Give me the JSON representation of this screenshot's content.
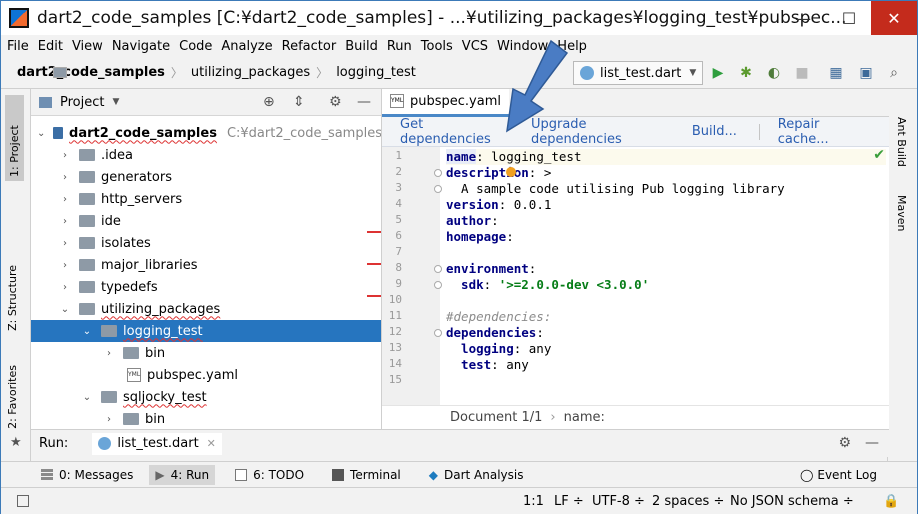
{
  "window": {
    "title": "dart2_code_samples [C:¥dart2_code_samples] - ...¥utilizing_packages¥logging_test¥pubspec...",
    "minimize": "—",
    "maximize": "☐",
    "close": "✕"
  },
  "menu": [
    "File",
    "Edit",
    "View",
    "Navigate",
    "Code",
    "Analyze",
    "Refactor",
    "Build",
    "Run",
    "Tools",
    "VCS",
    "Window",
    "Help"
  ],
  "breadcrumb": [
    "dart2_code_samples",
    "utilizing_packages",
    "logging_test"
  ],
  "run_config": "list_test.dart",
  "left_tool_tabs": {
    "project": "1: Project",
    "structure": "Z: Structure",
    "favorites": "2: Favorites"
  },
  "right_tool_tabs": {
    "ant": "Ant Build",
    "maven": "Maven"
  },
  "project_panel": {
    "title": "Project"
  },
  "tree": [
    {
      "label": "dart2_code_samples",
      "path": "C:¥dart2_code_samples",
      "arrow": "⌄",
      "depth": 0,
      "icon": "module"
    },
    {
      "label": ".idea",
      "arrow": "›",
      "depth": 1,
      "icon": "folder"
    },
    {
      "label": "generators",
      "arrow": "›",
      "depth": 1,
      "icon": "folder"
    },
    {
      "label": "http_servers",
      "arrow": "›",
      "depth": 1,
      "icon": "folder"
    },
    {
      "label": "ide",
      "arrow": "›",
      "depth": 1,
      "icon": "folder"
    },
    {
      "label": "isolates",
      "arrow": "›",
      "depth": 1,
      "icon": "folder"
    },
    {
      "label": "major_libraries",
      "arrow": "›",
      "depth": 1,
      "icon": "folder"
    },
    {
      "label": "typedefs",
      "arrow": "›",
      "depth": 1,
      "icon": "folder"
    },
    {
      "label": "utilizing_packages",
      "arrow": "⌄",
      "depth": 1,
      "icon": "folder"
    },
    {
      "label": "logging_test",
      "arrow": "⌄",
      "depth": 2,
      "icon": "folder",
      "selected": true
    },
    {
      "label": "bin",
      "arrow": "›",
      "depth": 3,
      "icon": "folder"
    },
    {
      "label": "pubspec.yaml",
      "arrow": "",
      "depth": 3,
      "icon": "yaml"
    },
    {
      "label": "sqljocky_test",
      "arrow": "⌄",
      "depth": 2,
      "icon": "folder"
    },
    {
      "label": "bin",
      "arrow": "›",
      "depth": 3,
      "icon": "folder"
    }
  ],
  "editor": {
    "tab": "pubspec.yaml",
    "yml_badge": "YML",
    "actions": [
      "Get dependencies",
      "Upgrade dependencies",
      "Build...",
      "Repair cache..."
    ],
    "lines": [
      "1",
      "2",
      "3",
      "4",
      "5",
      "6",
      "7",
      "8",
      "9",
      "10",
      "11",
      "12",
      "13",
      "14",
      "15"
    ],
    "code": {
      "l1_key": "name",
      "l1_val": ": logging_test",
      "l2_key": "description",
      "l2_val": ": >",
      "l3": "  A sample code utilising Pub logging library",
      "l4_key": "version",
      "l4_val": ": 0.0.1",
      "l5_key": "author",
      "l5_val": ":",
      "l6_key": "homepage",
      "l6_val": ":",
      "l8_key": "environment",
      "l8_val": ":",
      "l9_key": "  sdk",
      "l9_colon": ": ",
      "l9_val": "'>=2.0.0-dev <3.0.0'",
      "l11": "#dependencies:",
      "l12_key": "dependencies",
      "l12_val": ":",
      "l13_key": "  logging",
      "l13_val": ": any",
      "l14_key": "  test",
      "l14_val": ": any"
    },
    "status_doc": "Document 1/1",
    "status_sep": "›",
    "status_name": "name:"
  },
  "run_panel": {
    "label": "Run:",
    "tab": "list_test.dart",
    "close": "✕"
  },
  "bottom_tabs": [
    {
      "label": "0: Messages"
    },
    {
      "label": "4: Run",
      "selected": true
    },
    {
      "label": "6: TODO"
    },
    {
      "label": "Terminal"
    },
    {
      "label": "Dart Analysis"
    }
  ],
  "event_log": "Event Log",
  "status": {
    "pos": "1:1",
    "lf": "LF ÷",
    "enc": "UTF-8 ÷",
    "indent": "2 spaces ÷",
    "schema": "No JSON schema ÷"
  },
  "colors": {
    "accent": "#2675bf",
    "link": "#2a5db0",
    "selection": "#2675bf"
  }
}
